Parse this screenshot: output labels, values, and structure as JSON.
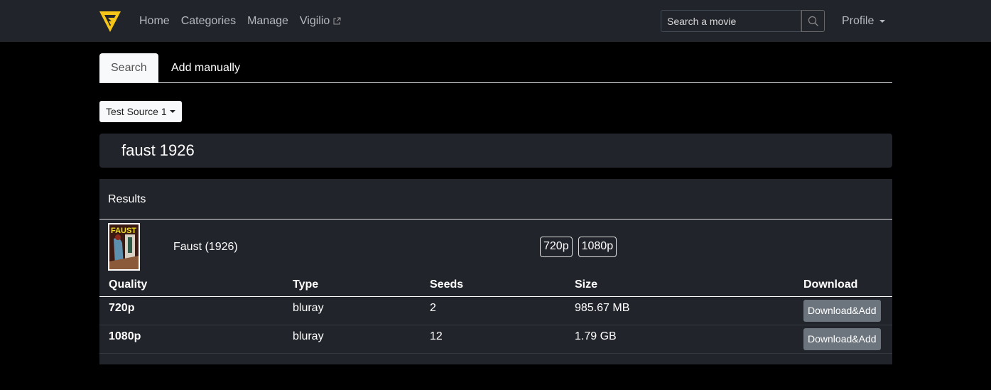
{
  "nav": {
    "brand_icon": "vigilio-logo",
    "links": [
      "Home",
      "Categories",
      "Manage",
      "Vigilio"
    ],
    "external_icon": "external-link-icon",
    "search_placeholder": "Search a movie",
    "search_icon": "search-icon",
    "profile_label": "Profile"
  },
  "tabs": [
    {
      "label": "Search",
      "active": true
    },
    {
      "label": "Add manually",
      "active": false
    }
  ],
  "source_dropdown": {
    "selected": "Test Source 1"
  },
  "query": "faust 1926",
  "results": {
    "header": "Results",
    "movie": {
      "title": "Faust (1926)",
      "poster_text": "FAUST",
      "qualities": [
        "720p",
        "1080p"
      ]
    },
    "columns": [
      "Quality",
      "Type",
      "Seeds",
      "Size",
      "Download"
    ],
    "rows": [
      {
        "quality": "720p",
        "type": "bluray",
        "seeds": "2",
        "size": "985.67 MB",
        "action": "Download&Add"
      },
      {
        "quality": "1080p",
        "type": "bluray",
        "seeds": "12",
        "size": "1.79 GB",
        "action": "Download&Add"
      }
    ]
  },
  "colors": {
    "navbar_bg": "#21242b",
    "brand_yellow": "#f5c518",
    "button_gray": "#6c757d"
  }
}
